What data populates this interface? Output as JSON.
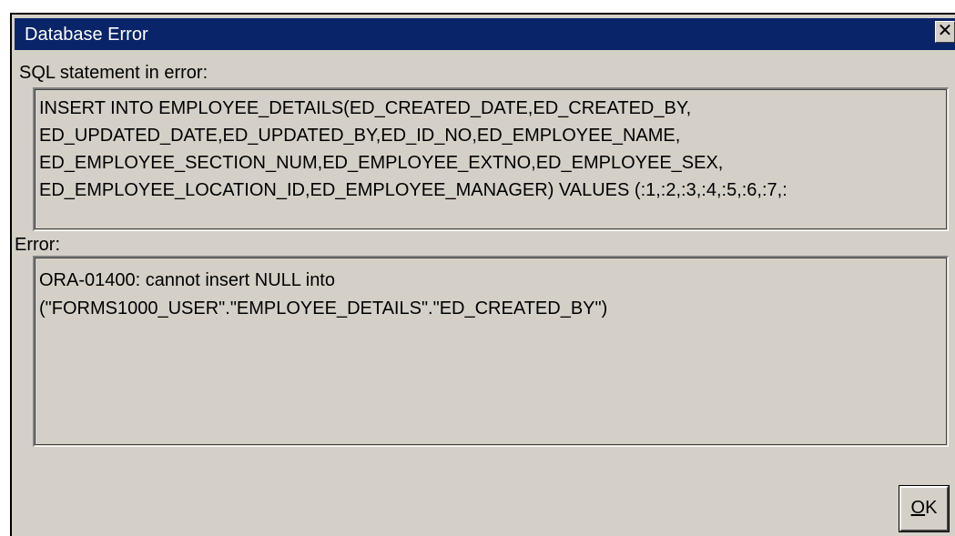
{
  "dialog": {
    "title": "Database Error",
    "close_glyph": "✕",
    "close_icon": "close-icon"
  },
  "sql": {
    "label": "SQL statement in error:",
    "lines": [
      "INSERT INTO EMPLOYEE_DETAILS(ED_CREATED_DATE,ED_CREATED_BY,",
      "ED_UPDATED_DATE,ED_UPDATED_BY,ED_ID_NO,ED_EMPLOYEE_NAME,",
      "ED_EMPLOYEE_SECTION_NUM,ED_EMPLOYEE_EXTNO,ED_EMPLOYEE_SEX,",
      "ED_EMPLOYEE_LOCATION_ID,ED_EMPLOYEE_MANAGER) VALUES (:1,:2,:3,:4,:5,:6,:7,:"
    ]
  },
  "error": {
    "label": "Error:",
    "lines": [
      "ORA-01400: cannot insert NULL into",
      "(\"FORMS1000_USER\".\"EMPLOYEE_DETAILS\".\"ED_CREATED_BY\")"
    ]
  },
  "buttons": {
    "ok_mnemonic": "O",
    "ok_rest": "K"
  },
  "colors": {
    "titlebar": "#0a246a",
    "dialog_bg": "#d4d0c8"
  }
}
